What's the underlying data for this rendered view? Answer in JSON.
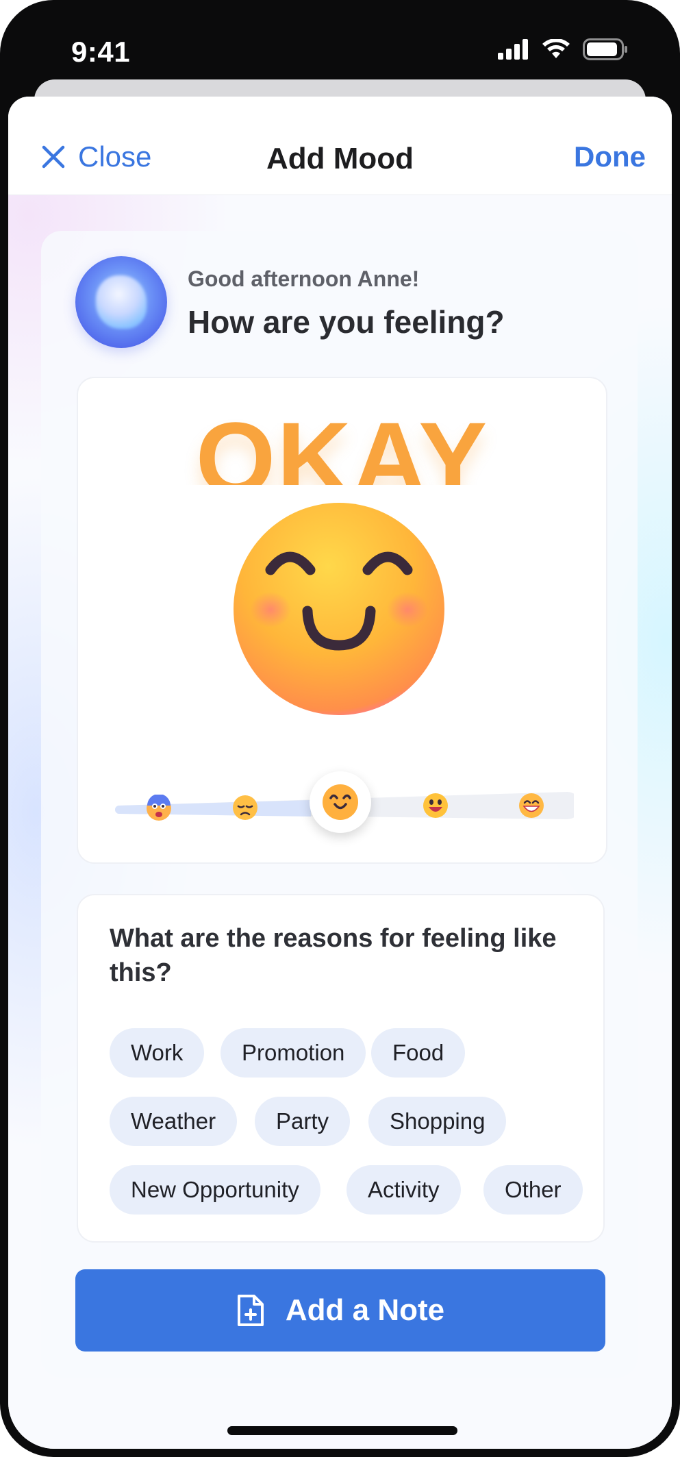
{
  "status_bar": {
    "time": "9:41"
  },
  "nav": {
    "close_label": "Close",
    "title": "Add Mood",
    "done_label": "Done"
  },
  "header": {
    "greeting": "Good afternoon Anne!",
    "question": "How are you feeling?"
  },
  "mood": {
    "label": "OKAY",
    "scale_icons": [
      "shocked-face-icon",
      "sad-face-icon",
      "smiling-face-icon",
      "happy-face-icon",
      "grinning-face-icon"
    ],
    "selected_index": 2,
    "selected_fraction": 0.5
  },
  "reasons": {
    "title": "What are the reasons for feeling like this?",
    "chips": [
      "Work",
      "Promotion",
      "Food",
      "Weather",
      "Party",
      "Shopping",
      "New Opportunity",
      "Activity",
      "Other"
    ]
  },
  "actions": {
    "add_note_label": "Add a Note"
  },
  "colors": {
    "accent": "#3a76e0",
    "mood": "#f9a43e",
    "chip_bg": "#e8eefa"
  }
}
